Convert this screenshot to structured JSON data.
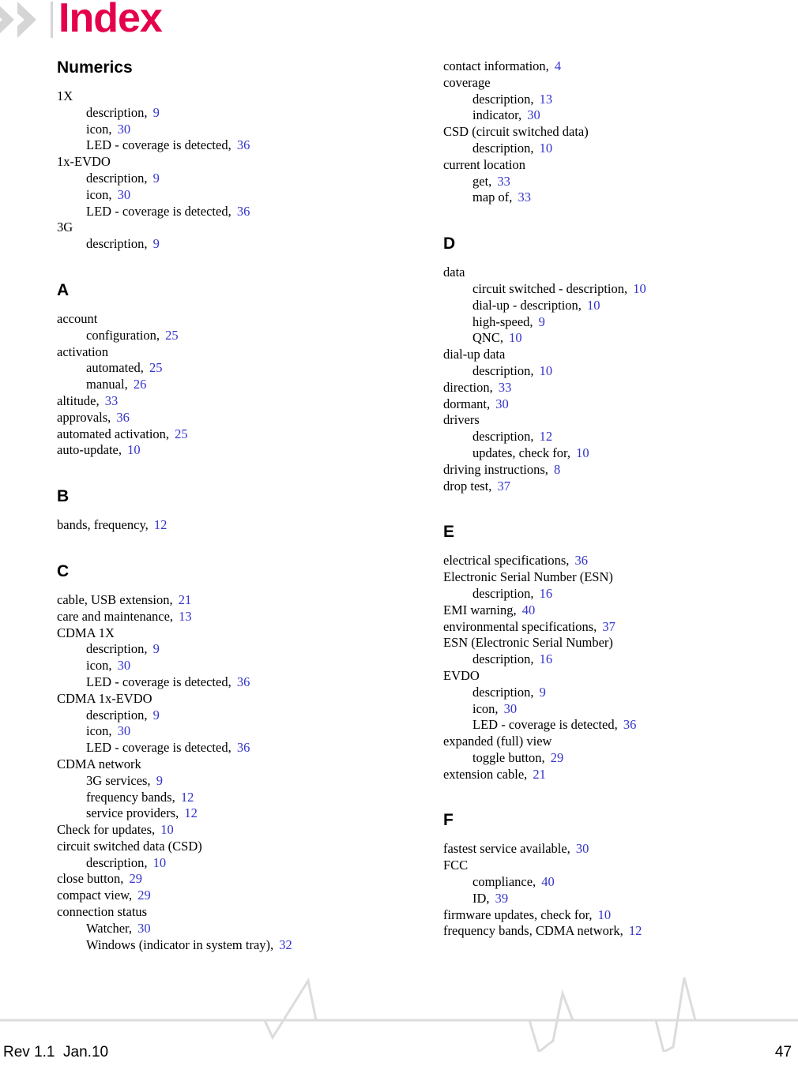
{
  "header": {
    "title": "Index",
    "logo_icon": "double-chevron-right-icon",
    "title_color": "#e4004b",
    "chevron_color": "#d5d5d5"
  },
  "colors": {
    "page_ref": "#3333cc",
    "text": "#000000",
    "accent": "#e4004b",
    "wave": "#dcdcdc"
  },
  "columns": [
    {
      "name": "left",
      "sections": [
        {
          "heading": "Numerics",
          "entries": [
            {
              "level": 1,
              "label": "1X",
              "page": ""
            },
            {
              "level": 2,
              "label": "description,",
              "page": "9"
            },
            {
              "level": 2,
              "label": "icon,",
              "page": "30"
            },
            {
              "level": 2,
              "label": "LED - coverage is detected,",
              "page": "36"
            },
            {
              "level": 1,
              "label": "1x-EVDO",
              "page": ""
            },
            {
              "level": 2,
              "label": "description,",
              "page": "9"
            },
            {
              "level": 2,
              "label": "icon,",
              "page": "30"
            },
            {
              "level": 2,
              "label": "LED - coverage is detected,",
              "page": "36"
            },
            {
              "level": 1,
              "label": "3G",
              "page": ""
            },
            {
              "level": 2,
              "label": "description,",
              "page": "9"
            }
          ]
        },
        {
          "heading": "A",
          "entries": [
            {
              "level": 1,
              "label": "account",
              "page": ""
            },
            {
              "level": 2,
              "label": "configuration,",
              "page": "25"
            },
            {
              "level": 1,
              "label": "activation",
              "page": ""
            },
            {
              "level": 2,
              "label": "automated,",
              "page": "25"
            },
            {
              "level": 2,
              "label": "manual,",
              "page": "26"
            },
            {
              "level": 1,
              "label": "altitude,",
              "page": "33"
            },
            {
              "level": 1,
              "label": "approvals,",
              "page": "36"
            },
            {
              "level": 1,
              "label": "automated activation,",
              "page": "25"
            },
            {
              "level": 1,
              "label": "auto-update,",
              "page": "10"
            }
          ]
        },
        {
          "heading": "B",
          "entries": [
            {
              "level": 1,
              "label": "bands, frequency,",
              "page": "12"
            }
          ]
        },
        {
          "heading": "C",
          "entries": [
            {
              "level": 1,
              "label": "cable, USB extension,",
              "page": "21"
            },
            {
              "level": 1,
              "label": "care and maintenance,",
              "page": "13"
            },
            {
              "level": 1,
              "label": "CDMA 1X",
              "page": ""
            },
            {
              "level": 2,
              "label": "description,",
              "page": "9"
            },
            {
              "level": 2,
              "label": "icon,",
              "page": "30"
            },
            {
              "level": 2,
              "label": "LED - coverage is detected,",
              "page": "36"
            },
            {
              "level": 1,
              "label": "CDMA 1x-EVDO",
              "page": ""
            },
            {
              "level": 2,
              "label": "description,",
              "page": "9"
            },
            {
              "level": 2,
              "label": "icon,",
              "page": "30"
            },
            {
              "level": 2,
              "label": "LED - coverage is detected,",
              "page": "36"
            },
            {
              "level": 1,
              "label": "CDMA network",
              "page": ""
            },
            {
              "level": 2,
              "label": "3G services,",
              "page": "9"
            },
            {
              "level": 2,
              "label": "frequency bands,",
              "page": "12"
            },
            {
              "level": 2,
              "label": "service providers,",
              "page": "12"
            },
            {
              "level": 1,
              "label": "Check for updates,",
              "page": "10"
            },
            {
              "level": 1,
              "label": "circuit switched data (CSD)",
              "page": ""
            },
            {
              "level": 2,
              "label": "description,",
              "page": "10"
            },
            {
              "level": 1,
              "label": "close button,",
              "page": "29"
            },
            {
              "level": 1,
              "label": "compact view,",
              "page": "29"
            },
            {
              "level": 1,
              "label": "connection status",
              "page": ""
            },
            {
              "level": 2,
              "label": "Watcher,",
              "page": "30"
            },
            {
              "level": 2,
              "label": "Windows (indicator in system tray),",
              "page": "32"
            }
          ]
        }
      ]
    },
    {
      "name": "right",
      "sections": [
        {
          "heading": "",
          "entries": [
            {
              "level": 1,
              "label": "contact information,",
              "page": "4"
            },
            {
              "level": 1,
              "label": "coverage",
              "page": ""
            },
            {
              "level": 2,
              "label": "description,",
              "page": "13"
            },
            {
              "level": 2,
              "label": "indicator,",
              "page": "30"
            },
            {
              "level": 1,
              "label": "CSD (circuit switched data)",
              "page": ""
            },
            {
              "level": 2,
              "label": "description,",
              "page": "10"
            },
            {
              "level": 1,
              "label": "current location",
              "page": ""
            },
            {
              "level": 2,
              "label": "get,",
              "page": "33"
            },
            {
              "level": 2,
              "label": "map of,",
              "page": "33"
            }
          ]
        },
        {
          "heading": "D",
          "entries": [
            {
              "level": 1,
              "label": "data",
              "page": ""
            },
            {
              "level": 2,
              "label": "circuit switched - description,",
              "page": "10"
            },
            {
              "level": 2,
              "label": "dial-up - description,",
              "page": "10"
            },
            {
              "level": 2,
              "label": "high-speed,",
              "page": "9"
            },
            {
              "level": 2,
              "label": "QNC,",
              "page": "10"
            },
            {
              "level": 1,
              "label": "dial-up data",
              "page": ""
            },
            {
              "level": 2,
              "label": "description,",
              "page": "10"
            },
            {
              "level": 1,
              "label": "direction,",
              "page": "33"
            },
            {
              "level": 1,
              "label": "dormant,",
              "page": "30"
            },
            {
              "level": 1,
              "label": "drivers",
              "page": ""
            },
            {
              "level": 2,
              "label": "description,",
              "page": "12"
            },
            {
              "level": 2,
              "label": "updates, check for,",
              "page": "10"
            },
            {
              "level": 1,
              "label": "driving instructions,",
              "page": "8"
            },
            {
              "level": 1,
              "label": "drop test,",
              "page": "37"
            }
          ]
        },
        {
          "heading": "E",
          "entries": [
            {
              "level": 1,
              "label": "electrical specifications,",
              "page": "36"
            },
            {
              "level": 1,
              "label": "Electronic Serial Number (ESN)",
              "page": ""
            },
            {
              "level": 2,
              "label": "description,",
              "page": "16"
            },
            {
              "level": 1,
              "label": "EMI warning,",
              "page": "40"
            },
            {
              "level": 1,
              "label": "environmental specifications,",
              "page": "37"
            },
            {
              "level": 1,
              "label": "ESN (Electronic Serial Number)",
              "page": ""
            },
            {
              "level": 2,
              "label": "description,",
              "page": "16"
            },
            {
              "level": 1,
              "label": "EVDO",
              "page": ""
            },
            {
              "level": 2,
              "label": "description,",
              "page": "9"
            },
            {
              "level": 2,
              "label": "icon,",
              "page": "30"
            },
            {
              "level": 2,
              "label": "LED - coverage is detected,",
              "page": "36"
            },
            {
              "level": 1,
              "label": "expanded (full) view",
              "page": ""
            },
            {
              "level": 2,
              "label": "toggle button,",
              "page": "29"
            },
            {
              "level": 1,
              "label": "extension cable,",
              "page": "21"
            }
          ]
        },
        {
          "heading": "F",
          "entries": [
            {
              "level": 1,
              "label": "fastest service available,",
              "page": "30"
            },
            {
              "level": 1,
              "label": "FCC",
              "page": ""
            },
            {
              "level": 2,
              "label": "compliance,",
              "page": "40"
            },
            {
              "level": 2,
              "label": "ID,",
              "page": "39"
            },
            {
              "level": 1,
              "label": "firmware updates, check for,",
              "page": "10"
            },
            {
              "level": 1,
              "label": "frequency bands, CDMA network,",
              "page": "12"
            }
          ]
        }
      ]
    }
  ],
  "footer": {
    "revision": "Rev 1.1  Jan.10",
    "page_number": "47",
    "decoration_icon": "waveform-line-icon"
  }
}
